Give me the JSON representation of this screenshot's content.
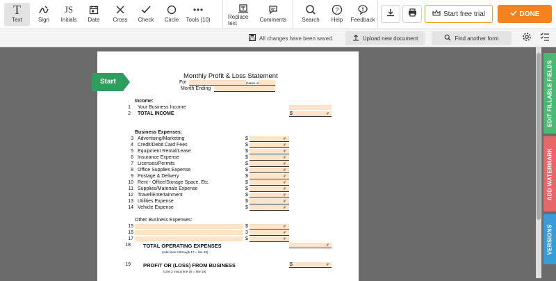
{
  "toolbar": {
    "tools": [
      {
        "label": "Text",
        "icon": "text-icon"
      },
      {
        "label": "Sign",
        "icon": "sign-icon"
      },
      {
        "label": "Initials",
        "icon": "initials-icon"
      },
      {
        "label": "Date",
        "icon": "date-icon"
      },
      {
        "label": "Cross",
        "icon": "cross-icon"
      },
      {
        "label": "Check",
        "icon": "check-icon"
      },
      {
        "label": "Circle",
        "icon": "circle-icon"
      },
      {
        "label": "Tools (10)",
        "icon": "more-tools-icon"
      }
    ],
    "initials_glyph": "JS",
    "text_glyph": "T",
    "replace_text": "Replace text",
    "comments": "Comments",
    "search": "Search",
    "help": "Help",
    "feedback": "Feedback",
    "trial": "Start free trial",
    "done": "DONE"
  },
  "subbar": {
    "saved": "All changes have been saved.",
    "upload": "Upload new document",
    "find": "Find another form"
  },
  "start_tag": "Start",
  "document": {
    "title": "Monthly Profit & Loss Statement",
    "for_label": "For",
    "business_hint": "(Name of Business)",
    "month_label": "Month Ending",
    "income_heading": "Income:",
    "income_rows": [
      {
        "num": "1",
        "label": "Your Business Income"
      },
      {
        "num": "2",
        "label": "TOTAL INCOME"
      }
    ],
    "expenses_heading": "Business Expenses:",
    "expense_rows": [
      {
        "num": "3",
        "label": "Advertising/Marketing"
      },
      {
        "num": "4",
        "label": "Credit/Debit Card Fees"
      },
      {
        "num": "5",
        "label": "Equipment Rental/Lease"
      },
      {
        "num": "6",
        "label": "Insurance Expense"
      },
      {
        "num": "7",
        "label": "Licenses/Permits"
      },
      {
        "num": "8",
        "label": "Office Supplies Expense"
      },
      {
        "num": "9",
        "label": "Postage & Delivery"
      },
      {
        "num": "10",
        "label": "Rent - Office/Storage Space, Etc."
      },
      {
        "num": "11",
        "label": "Supplies/Materials Expense"
      },
      {
        "num": "12",
        "label": "Travel/Entertainment"
      },
      {
        "num": "13",
        "label": "Utilities Expense"
      },
      {
        "num": "14",
        "label": "Vehicle Expense"
      }
    ],
    "other_heading": "Other Business Expenses:",
    "other_rows": [
      {
        "num": "15",
        "marker": "$"
      },
      {
        "num": "16",
        "marker": "3"
      },
      {
        "num": "17",
        "marker": "$"
      }
    ],
    "total_operating": {
      "num": "18",
      "label": "TOTAL OPERATING EXPENSES",
      "note": "(Add lines 3 through 17 = line 18)"
    },
    "profit": {
      "num": "19",
      "label": "PROFIT OR (LOSS) FROM BUSINESS",
      "note": "(Line 2 minus line 18 = line 19)"
    },
    "dollar": "$",
    "hash": "#"
  },
  "sidetabs": {
    "edit": "EDIT FILLABLE FIELDS",
    "watermark": "ADD WATERMARK",
    "versions": "VERSIONS"
  },
  "colors": {
    "orange": "#f58220",
    "field": "#fde3c7",
    "start_green": "#2e9e5e",
    "tab_green": "#4bb874",
    "tab_red": "#e8676b",
    "tab_blue": "#3a9bd9"
  }
}
